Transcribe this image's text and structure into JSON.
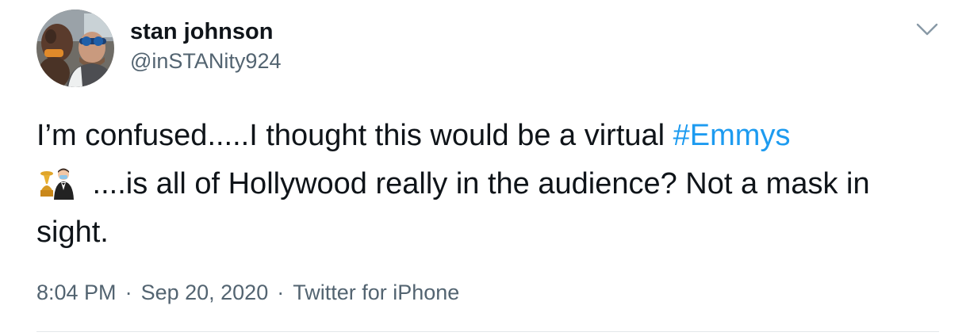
{
  "tweet": {
    "author": {
      "display_name": "stan johnson",
      "handle": "@inSTANity924"
    },
    "text": {
      "part1": "I’m confused.....I thought this would be a virtual ",
      "hashtag": "#Emmys",
      "part2": " ....is all of Hollywood really in the audience?  Not a mask in sight."
    },
    "emoji": "man-with-mask-and-emmy-trophy-emoji",
    "meta": {
      "time": "8:04 PM",
      "separator": "·",
      "date": "Sep 20, 2020",
      "source": "Twitter for iPhone"
    }
  },
  "colors": {
    "text": "#0f1419",
    "secondary": "#536471",
    "link": "#1d9bf0",
    "divider": "#e3e7ea"
  }
}
